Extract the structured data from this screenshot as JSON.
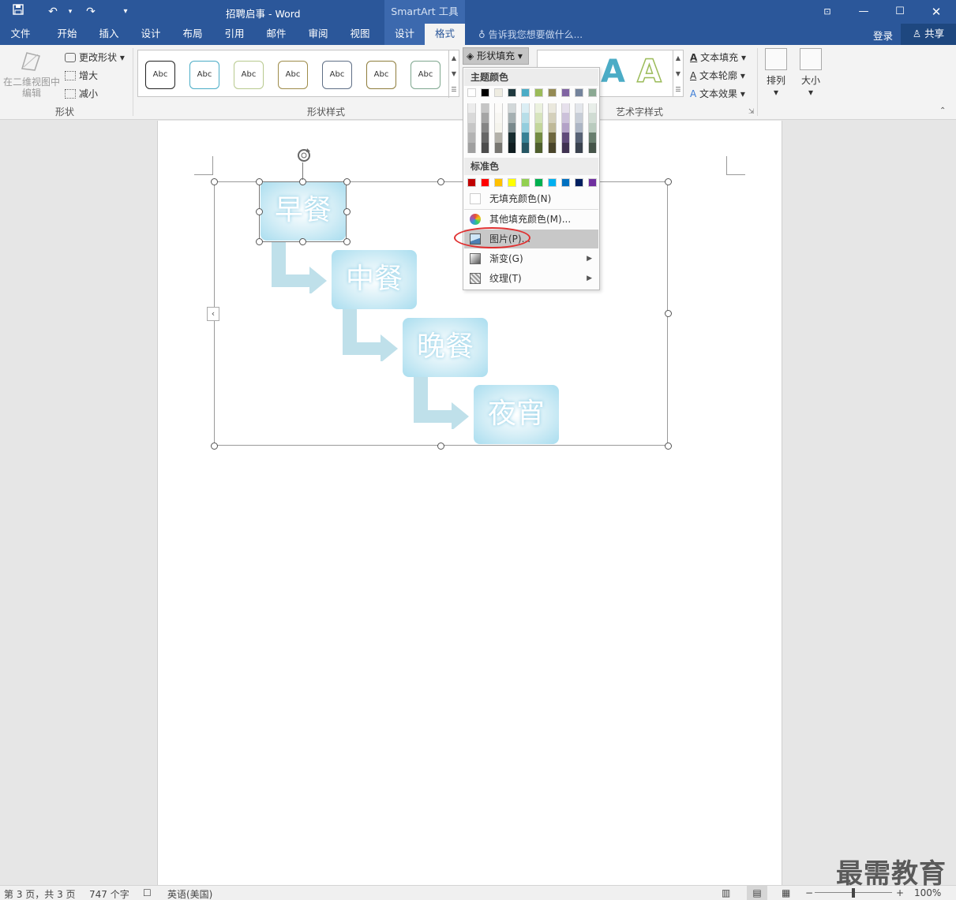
{
  "titlebar": {
    "doc_title": "招聘启事 - Word",
    "context_tool": "SmartArt 工具",
    "save_icon": "save-icon",
    "undo_icon": "undo-icon",
    "redo_icon": "redo-icon"
  },
  "tabs": [
    "文件",
    "开始",
    "插入",
    "设计",
    "布局",
    "引用",
    "邮件",
    "审阅",
    "视图",
    "设计",
    "格式"
  ],
  "tell_me": "告诉我您想要做什么...",
  "login": "登录",
  "share": "共享",
  "ribbon": {
    "shapes_group": {
      "edit_2d": "在二维视图中编辑",
      "change_shape": "更改形状",
      "larger": "增大",
      "smaller": "减小",
      "label": "形状"
    },
    "shape_styles": {
      "label": "形状样式",
      "sample": "Abc",
      "shape_fill": "形状填充"
    },
    "wordart": {
      "label": "艺术字样式",
      "text_fill": "文本填充",
      "text_outline": "文本轮廓",
      "text_effects": "文本效果"
    },
    "arrange": "排列",
    "size": "大小"
  },
  "fill_menu": {
    "theme_colors": "主题颜色",
    "standard_colors": "标准色",
    "no_fill": "无填充颜色(N)",
    "more_colors": "其他填充颜色(M)...",
    "picture": "图片(P)...",
    "gradient": "渐变(G)",
    "texture": "纹理(T)",
    "theme_row": [
      "#ffffff",
      "#000000",
      "#eeece1",
      "#1f3a3f",
      "#4bacc6",
      "#9bbb59",
      "#948a54",
      "#8064a2",
      "#74839c",
      "#8aa892"
    ],
    "standard_row": [
      "#c00000",
      "#ff0000",
      "#ffc000",
      "#ffff00",
      "#92d050",
      "#00b050",
      "#00b0f0",
      "#0070c0",
      "#002060",
      "#7030a0"
    ]
  },
  "smartart": {
    "nodes": [
      "早餐",
      "中餐",
      "晚餐",
      "夜宵"
    ]
  },
  "status": {
    "page": "第 3 页，共 3 页",
    "words": "747 个字",
    "language": "英语(美国)",
    "zoom": "100%"
  },
  "watermark": "最需教育"
}
